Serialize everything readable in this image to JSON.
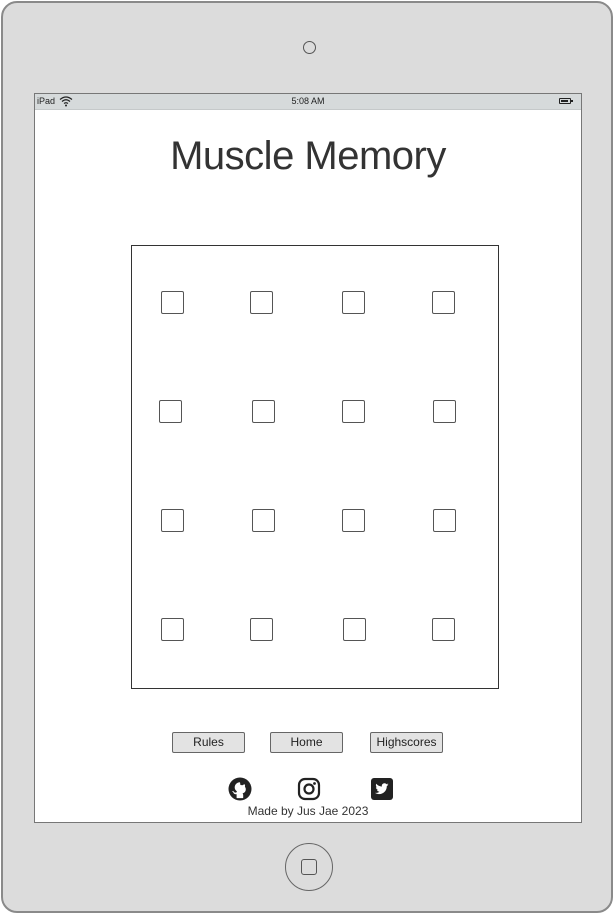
{
  "device": {
    "model_label": "iPad",
    "time": "5:08 AM"
  },
  "page": {
    "title": "Muscle Memory"
  },
  "board": {
    "rows": [
      [
        "",
        "",
        "",
        ""
      ],
      [
        "",
        "",
        "",
        ""
      ],
      [
        "",
        "",
        "",
        ""
      ],
      [
        "",
        "",
        "",
        ""
      ]
    ]
  },
  "nav": {
    "rules_label": "Rules",
    "home_label": "Home",
    "highscores_label": "Highscores"
  },
  "social": {
    "icons": [
      "github-icon",
      "instagram-icon",
      "twitter-icon"
    ]
  },
  "footer": {
    "text": "Made by Jus Jae 2023"
  }
}
